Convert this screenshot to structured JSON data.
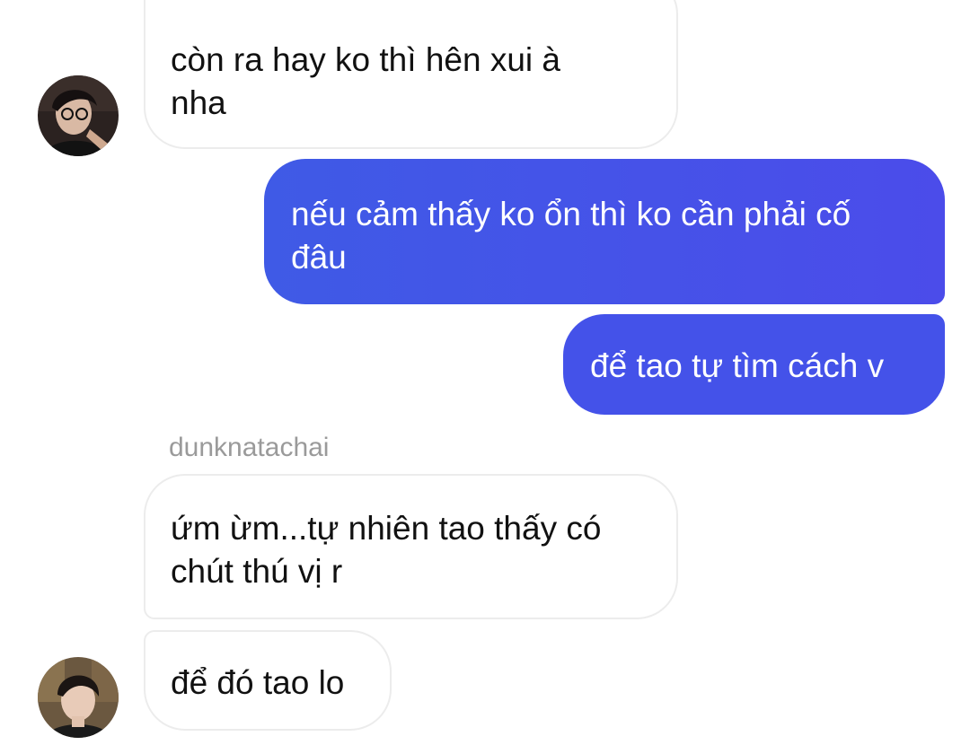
{
  "messages": [
    {
      "direction": "incoming",
      "text": "còn ra hay ko thì hên xui à\nnha"
    },
    {
      "direction": "outgoing",
      "text": "nếu cảm thấy ko ổn thì ko cần phải cố\nđâu"
    },
    {
      "direction": "outgoing",
      "text": "để tao tự tìm cách v"
    },
    {
      "direction": "incoming",
      "sender": "dunknatachai",
      "text": "ứm ừm...tự nhiên tao thấy có\nchút thú vị r"
    },
    {
      "direction": "incoming",
      "text": "để đó tao lo"
    }
  ],
  "colors": {
    "outgoing_bubble": "#4452e9",
    "incoming_border": "#ececec",
    "sender_name": "#9a9a9a"
  },
  "icons": {
    "avatar_1": "profile-photo",
    "avatar_2": "profile-photo"
  }
}
